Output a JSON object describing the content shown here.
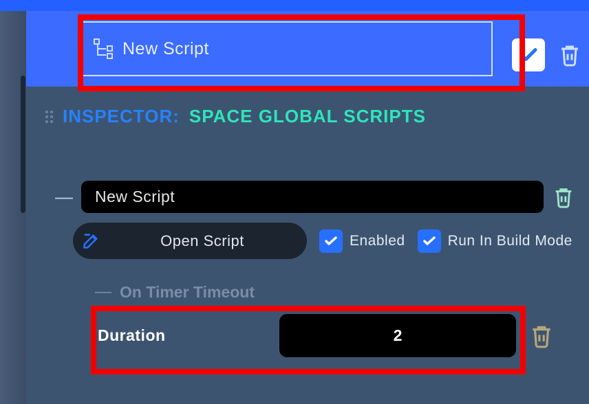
{
  "header": {
    "script_title": "New Script"
  },
  "inspector": {
    "label": "INSPECTOR:",
    "subtitle": "SPACE GLOBAL SCRIPTS"
  },
  "script": {
    "name": "New Script",
    "open_label": "Open Script",
    "enabled_label": "Enabled",
    "enabled": true,
    "run_build_label": "Run In Build Mode",
    "run_build": true
  },
  "section": {
    "title": "On Timer Timeout",
    "duration_label": "Duration",
    "duration_value": "2"
  },
  "colors": {
    "accent_blue": "#3b6bff",
    "check_blue": "#2770ff",
    "red_highlight": "#f20000",
    "teal": "#2de5bb"
  }
}
